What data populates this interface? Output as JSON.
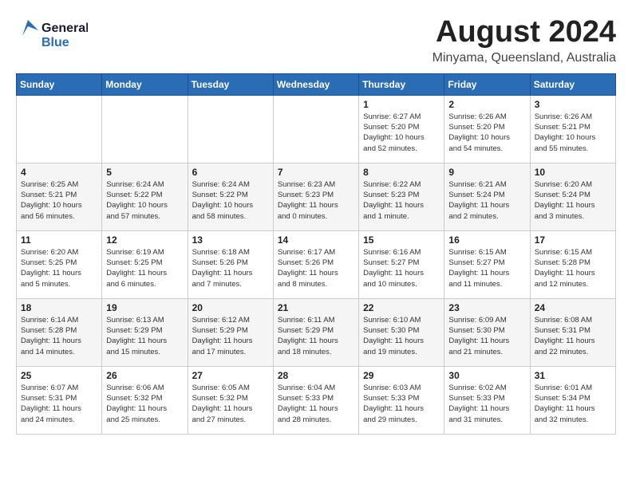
{
  "logo": {
    "line1": "General",
    "line2": "Blue"
  },
  "title": {
    "month_year": "August 2024",
    "location": "Minyama, Queensland, Australia"
  },
  "headers": [
    "Sunday",
    "Monday",
    "Tuesday",
    "Wednesday",
    "Thursday",
    "Friday",
    "Saturday"
  ],
  "weeks": [
    [
      {
        "day": "",
        "info": ""
      },
      {
        "day": "",
        "info": ""
      },
      {
        "day": "",
        "info": ""
      },
      {
        "day": "",
        "info": ""
      },
      {
        "day": "1",
        "info": "Sunrise: 6:27 AM\nSunset: 5:20 PM\nDaylight: 10 hours\nand 52 minutes."
      },
      {
        "day": "2",
        "info": "Sunrise: 6:26 AM\nSunset: 5:20 PM\nDaylight: 10 hours\nand 54 minutes."
      },
      {
        "day": "3",
        "info": "Sunrise: 6:26 AM\nSunset: 5:21 PM\nDaylight: 10 hours\nand 55 minutes."
      }
    ],
    [
      {
        "day": "4",
        "info": "Sunrise: 6:25 AM\nSunset: 5:21 PM\nDaylight: 10 hours\nand 56 minutes."
      },
      {
        "day": "5",
        "info": "Sunrise: 6:24 AM\nSunset: 5:22 PM\nDaylight: 10 hours\nand 57 minutes."
      },
      {
        "day": "6",
        "info": "Sunrise: 6:24 AM\nSunset: 5:22 PM\nDaylight: 10 hours\nand 58 minutes."
      },
      {
        "day": "7",
        "info": "Sunrise: 6:23 AM\nSunset: 5:23 PM\nDaylight: 11 hours\nand 0 minutes."
      },
      {
        "day": "8",
        "info": "Sunrise: 6:22 AM\nSunset: 5:23 PM\nDaylight: 11 hours\nand 1 minute."
      },
      {
        "day": "9",
        "info": "Sunrise: 6:21 AM\nSunset: 5:24 PM\nDaylight: 11 hours\nand 2 minutes."
      },
      {
        "day": "10",
        "info": "Sunrise: 6:20 AM\nSunset: 5:24 PM\nDaylight: 11 hours\nand 3 minutes."
      }
    ],
    [
      {
        "day": "11",
        "info": "Sunrise: 6:20 AM\nSunset: 5:25 PM\nDaylight: 11 hours\nand 5 minutes."
      },
      {
        "day": "12",
        "info": "Sunrise: 6:19 AM\nSunset: 5:25 PM\nDaylight: 11 hours\nand 6 minutes."
      },
      {
        "day": "13",
        "info": "Sunrise: 6:18 AM\nSunset: 5:26 PM\nDaylight: 11 hours\nand 7 minutes."
      },
      {
        "day": "14",
        "info": "Sunrise: 6:17 AM\nSunset: 5:26 PM\nDaylight: 11 hours\nand 8 minutes."
      },
      {
        "day": "15",
        "info": "Sunrise: 6:16 AM\nSunset: 5:27 PM\nDaylight: 11 hours\nand 10 minutes."
      },
      {
        "day": "16",
        "info": "Sunrise: 6:15 AM\nSunset: 5:27 PM\nDaylight: 11 hours\nand 11 minutes."
      },
      {
        "day": "17",
        "info": "Sunrise: 6:15 AM\nSunset: 5:28 PM\nDaylight: 11 hours\nand 12 minutes."
      }
    ],
    [
      {
        "day": "18",
        "info": "Sunrise: 6:14 AM\nSunset: 5:28 PM\nDaylight: 11 hours\nand 14 minutes."
      },
      {
        "day": "19",
        "info": "Sunrise: 6:13 AM\nSunset: 5:29 PM\nDaylight: 11 hours\nand 15 minutes."
      },
      {
        "day": "20",
        "info": "Sunrise: 6:12 AM\nSunset: 5:29 PM\nDaylight: 11 hours\nand 17 minutes."
      },
      {
        "day": "21",
        "info": "Sunrise: 6:11 AM\nSunset: 5:29 PM\nDaylight: 11 hours\nand 18 minutes."
      },
      {
        "day": "22",
        "info": "Sunrise: 6:10 AM\nSunset: 5:30 PM\nDaylight: 11 hours\nand 19 minutes."
      },
      {
        "day": "23",
        "info": "Sunrise: 6:09 AM\nSunset: 5:30 PM\nDaylight: 11 hours\nand 21 minutes."
      },
      {
        "day": "24",
        "info": "Sunrise: 6:08 AM\nSunset: 5:31 PM\nDaylight: 11 hours\nand 22 minutes."
      }
    ],
    [
      {
        "day": "25",
        "info": "Sunrise: 6:07 AM\nSunset: 5:31 PM\nDaylight: 11 hours\nand 24 minutes."
      },
      {
        "day": "26",
        "info": "Sunrise: 6:06 AM\nSunset: 5:32 PM\nDaylight: 11 hours\nand 25 minutes."
      },
      {
        "day": "27",
        "info": "Sunrise: 6:05 AM\nSunset: 5:32 PM\nDaylight: 11 hours\nand 27 minutes."
      },
      {
        "day": "28",
        "info": "Sunrise: 6:04 AM\nSunset: 5:33 PM\nDaylight: 11 hours\nand 28 minutes."
      },
      {
        "day": "29",
        "info": "Sunrise: 6:03 AM\nSunset: 5:33 PM\nDaylight: 11 hours\nand 29 minutes."
      },
      {
        "day": "30",
        "info": "Sunrise: 6:02 AM\nSunset: 5:33 PM\nDaylight: 11 hours\nand 31 minutes."
      },
      {
        "day": "31",
        "info": "Sunrise: 6:01 AM\nSunset: 5:34 PM\nDaylight: 11 hours\nand 32 minutes."
      }
    ]
  ]
}
